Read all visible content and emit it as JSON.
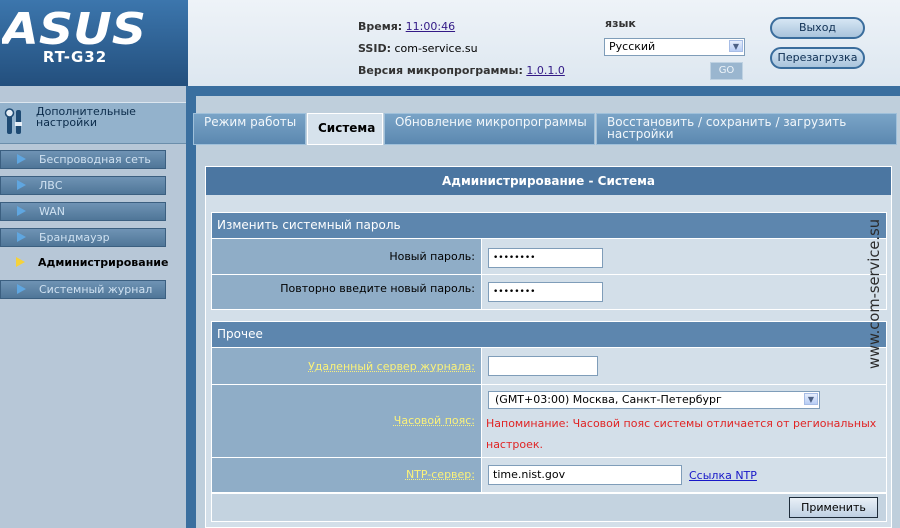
{
  "header": {
    "brand_logo": "ASUS",
    "model": "RT-G32",
    "time_label": "Время:",
    "time_value": "11:00:46",
    "ssid_label": "SSID:",
    "ssid_value": "com-service.su",
    "firmware_label": "Версия микропрограммы:",
    "firmware_value": "1.0.1.0",
    "language_label": "язык",
    "language_value": "Русский",
    "go_label": "GO",
    "logout_label": "Выход",
    "reboot_label": "Перезагрузка"
  },
  "sidebar": {
    "title": "Дополнительные настройки",
    "items": [
      {
        "label": "Беспроводная сеть"
      },
      {
        "label": "ЛВС"
      },
      {
        "label": "WAN"
      },
      {
        "label": "Брандмауэр"
      },
      {
        "label": "Администрирование"
      },
      {
        "label": "Системный журнал"
      }
    ]
  },
  "tabs": [
    {
      "label": "Режим работы"
    },
    {
      "label": "Система"
    },
    {
      "label": "Обновление микропрограммы"
    },
    {
      "label": "Восстановить / сохранить / загрузить настройки"
    }
  ],
  "panel": {
    "title": "Администрирование - Система",
    "password_section": {
      "title": "Изменить системный пароль",
      "new_password_label": "Новый пароль:",
      "new_password_value": "••••••••",
      "repeat_password_label": "Повторно введите новый пароль:",
      "repeat_password_value": "••••••••"
    },
    "misc_section": {
      "title": "Прочее",
      "log_server_label": "Удаленный сервер журнала:",
      "log_server_value": "",
      "timezone_label": "Часовой пояс:",
      "timezone_value": "(GMT+03:00) Москва, Санкт-Петербург",
      "timezone_warning": "Напоминание: Часовой пояс системы отличается от региональных настроек.",
      "ntp_label": "NTP-сервер:",
      "ntp_value": "time.nist.gov",
      "ntp_link": "Ссылка NTP"
    },
    "apply_label": "Применить"
  },
  "watermark": "www.com-service.su",
  "colors": {
    "header_blue": "#2f6396",
    "frame_blue": "#3a6f9f",
    "panel_head": "#4b76a1",
    "warning_red": "#e02424",
    "hint_yellow": "#fbf27a"
  }
}
